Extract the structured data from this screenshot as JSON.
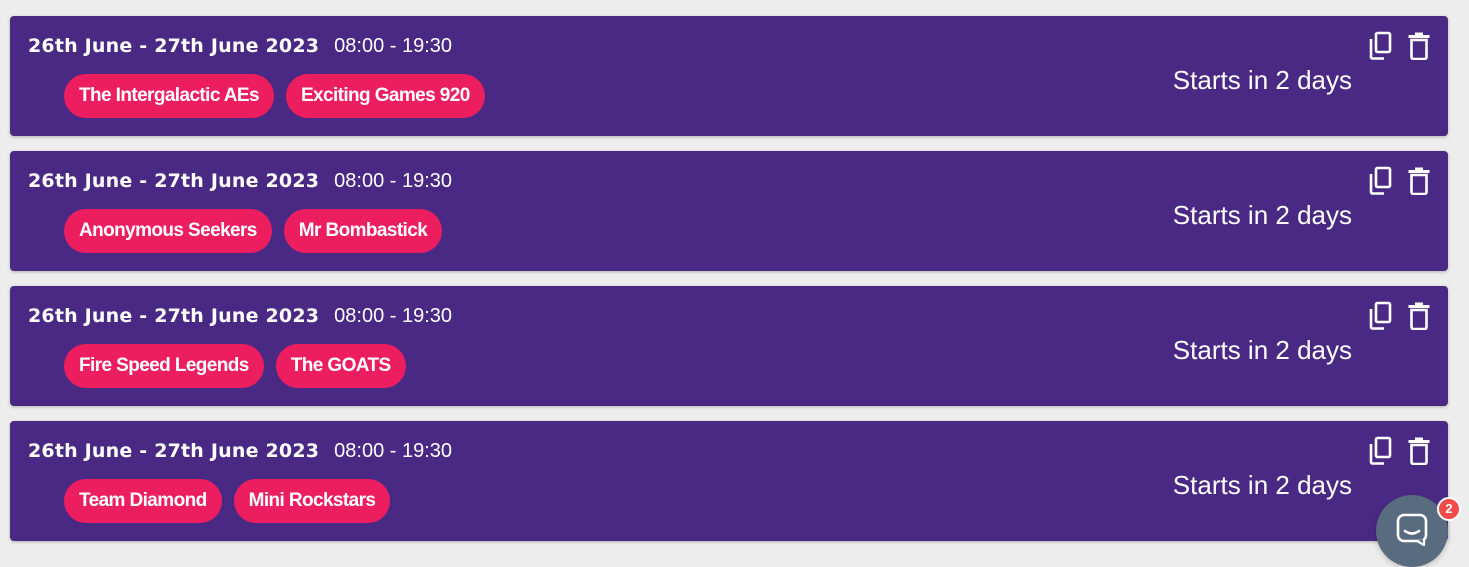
{
  "bookings": [
    {
      "date_range": "26th June - 27th June 2023",
      "time_range": "08:00 - 19:30",
      "teams": [
        "The Intergalactic AEs",
        "Exciting Games 920"
      ],
      "status": "Starts in 2 days",
      "actions": {
        "copy_icon": "copy-icon",
        "delete_icon": "trash-icon"
      }
    },
    {
      "date_range": "26th June - 27th June 2023",
      "time_range": "08:00 - 19:30",
      "teams": [
        "Anonymous Seekers",
        "Mr Bombastick"
      ],
      "status": "Starts in 2 days",
      "actions": {
        "copy_icon": "copy-icon",
        "delete_icon": "trash-icon"
      }
    },
    {
      "date_range": "26th June - 27th June 2023",
      "time_range": "08:00 - 19:30",
      "teams": [
        "Fire Speed Legends",
        "The GOATS"
      ],
      "status": "Starts in 2 days",
      "actions": {
        "copy_icon": "copy-icon",
        "delete_icon": "trash-icon"
      }
    },
    {
      "date_range": "26th June - 27th June 2023",
      "time_range": "08:00 - 19:30",
      "teams": [
        "Team Diamond",
        "Mini Rockstars"
      ],
      "status": "Starts in 2 days",
      "actions": {
        "copy_icon": "copy-icon",
        "delete_icon": "trash-icon"
      }
    }
  ],
  "chat_widget": {
    "icon": "chat-icon",
    "unread_count": "2"
  },
  "colors": {
    "page_background": "#ededed",
    "card_background": "#4a2984",
    "chip_background": "#ec1e5f",
    "chat_background": "#596b7e",
    "badge_background": "#f24b4b"
  }
}
